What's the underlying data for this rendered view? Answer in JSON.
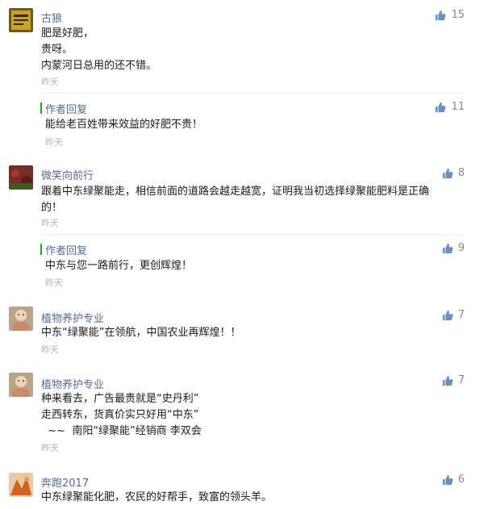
{
  "comments": [
    {
      "user": "古狼",
      "lines": [
        "肥是好肥，",
        "贵呀。",
        "内蒙河日总用的还不错。"
      ],
      "time": "昨天",
      "likes": "15",
      "reply": {
        "author": "作者回复",
        "text": "能给老百姓带来效益的好肥不贵！",
        "time": "昨天",
        "likes": "11"
      }
    },
    {
      "user": "微笑向前行",
      "lines": [
        "跟着中东绿聚能走，相信前面的道路会越走越宽，证明我当初选择绿聚能肥料是正确",
        "的！"
      ],
      "time": "昨天",
      "likes": "8",
      "reply": {
        "author": "作者回复",
        "text": "中东与您一路前行，更创辉煌！",
        "time": "昨天",
        "likes": "9"
      }
    },
    {
      "user": "植物养护专业",
      "lines": [
        "中东“绿聚能”在领航，中国农业再辉煌！！"
      ],
      "time": "昨天",
      "likes": "7"
    },
    {
      "user": "植物养护专业",
      "lines": [
        "种来看去，广告最贵就是“史丹利”",
        "走西转东，货真价实只好用“中东”",
        "  ~~  南阳“绿聚能”经销商 李双会"
      ],
      "time": "昨天",
      "likes": "7"
    },
    {
      "user": "奔跑2017",
      "lines": [
        "中东绿聚能化肥，农民的好帮手，致富的领头羊。"
      ],
      "likes": "6"
    }
  ],
  "colors": {
    "name": "#576b95",
    "time": "#b5b5b5",
    "reply_bar": "#1aad19",
    "like": "#8a8a8a"
  },
  "icons": {
    "like": "thumbs-up-icon"
  }
}
